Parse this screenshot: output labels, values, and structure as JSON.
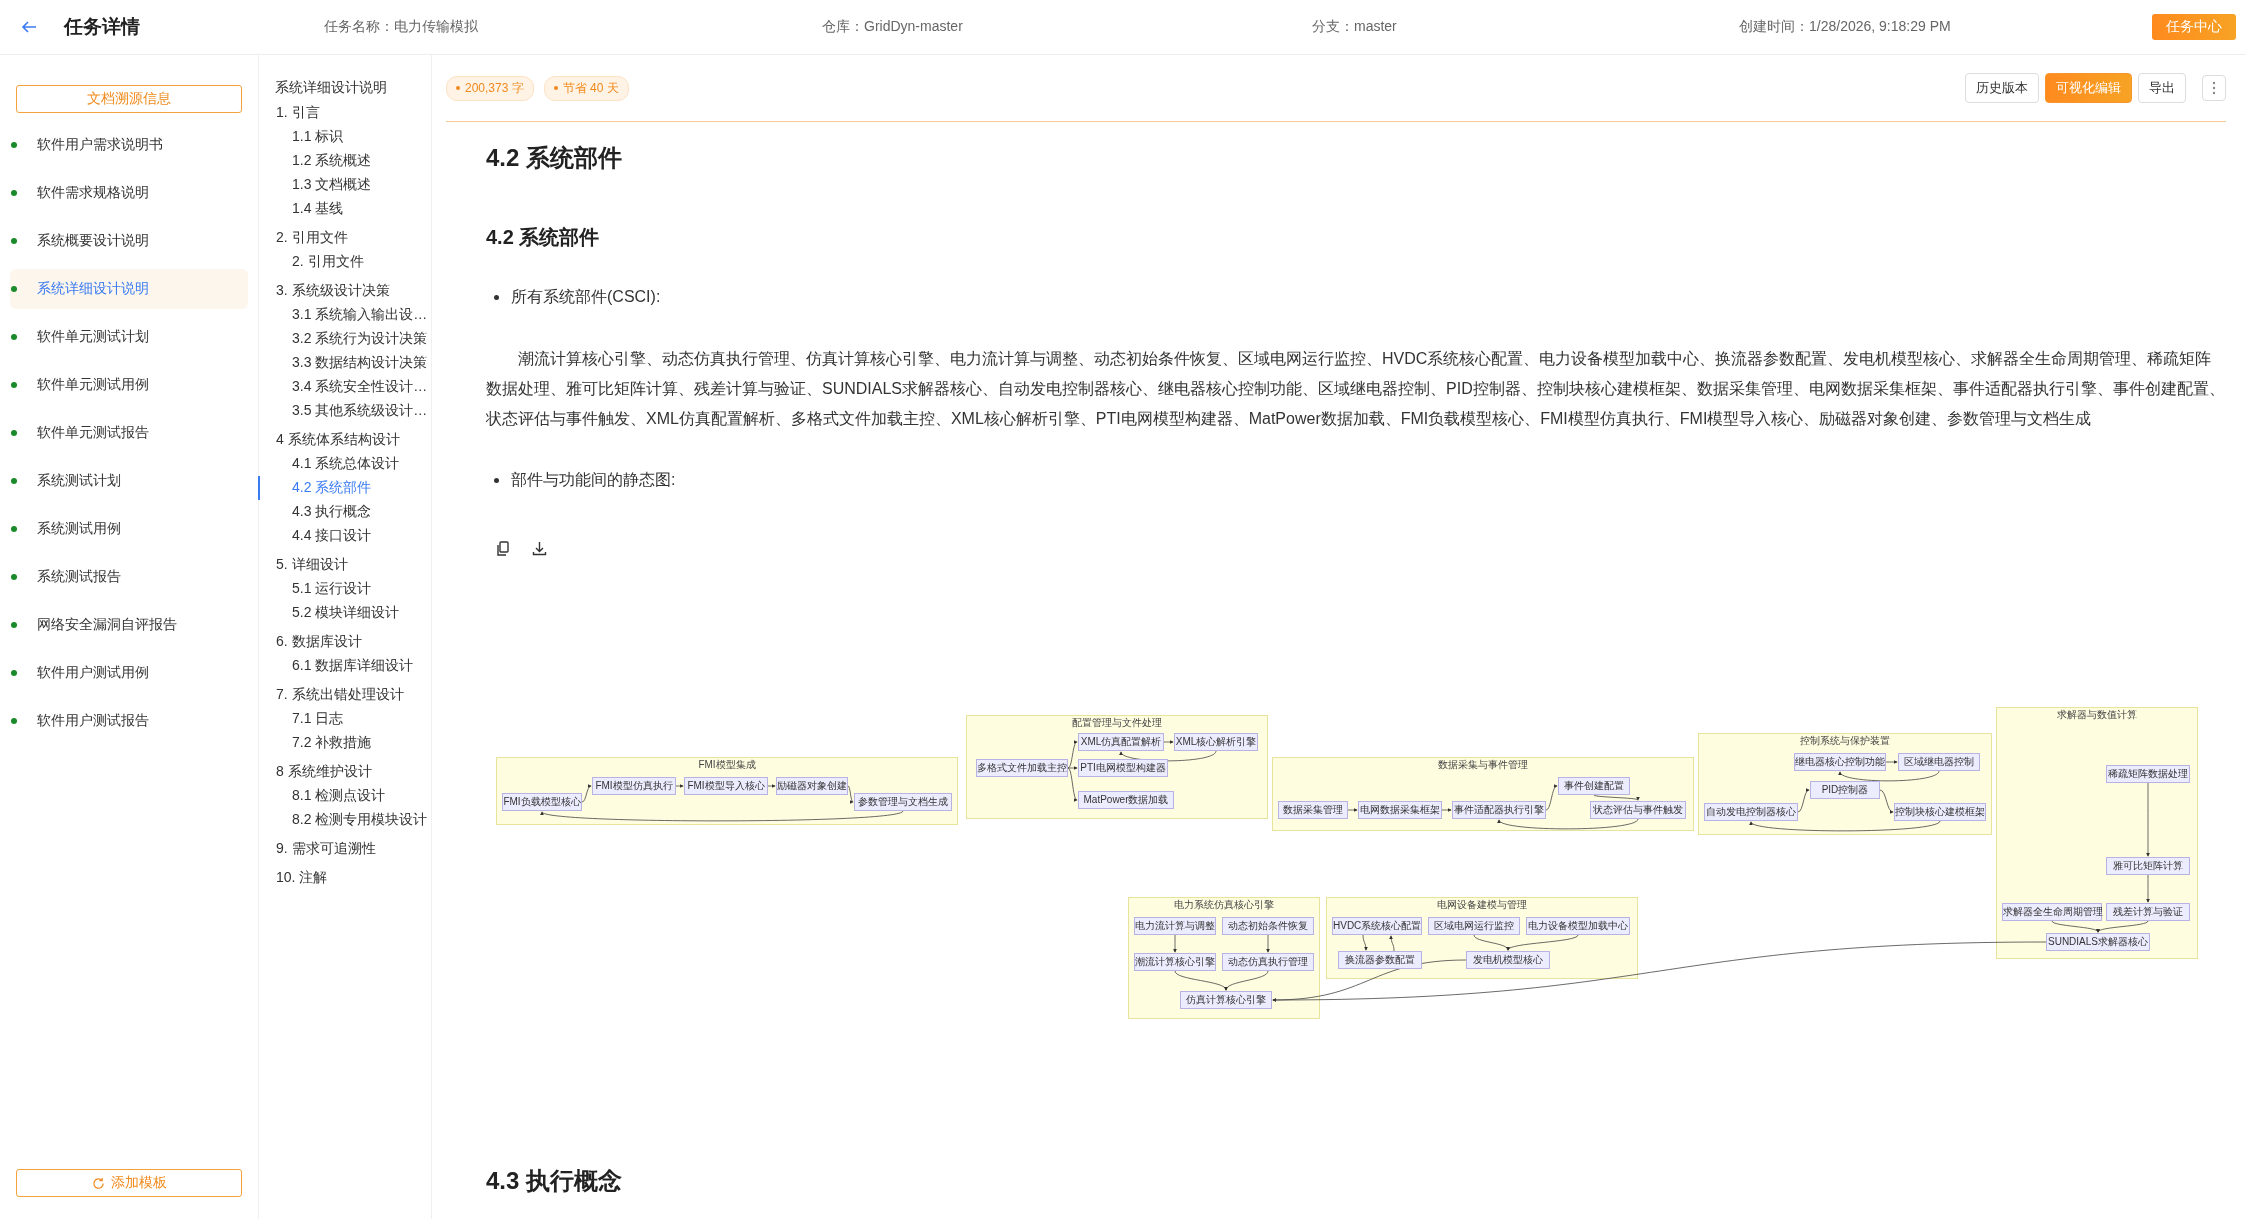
{
  "header": {
    "title": "任务详情",
    "meta": [
      "任务名称：电力传输模拟",
      "仓库：GridDyn-master",
      "分支：master",
      "创建时间：1/28/2026, 9:18:29 PM"
    ],
    "button": "任务中心"
  },
  "doc_list": {
    "button": "文档溯源信息",
    "items": [
      {
        "label": "软件用户需求说明书",
        "selected": false
      },
      {
        "label": "软件需求规格说明",
        "selected": false
      },
      {
        "label": "系统概要设计说明",
        "selected": false
      },
      {
        "label": "系统详细设计说明",
        "selected": true
      },
      {
        "label": "软件单元测试计划",
        "selected": false
      },
      {
        "label": "软件单元测试用例",
        "selected": false
      },
      {
        "label": "软件单元测试报告",
        "selected": false
      },
      {
        "label": "系统测试计划",
        "selected": false
      },
      {
        "label": "系统测试用例",
        "selected": false
      },
      {
        "label": "系统测试报告",
        "selected": false
      },
      {
        "label": "网络安全漏洞自评报告",
        "selected": false
      },
      {
        "label": "软件用户测试用例",
        "selected": false
      },
      {
        "label": "软件用户测试报告",
        "selected": false
      }
    ],
    "add_button": "添加模板"
  },
  "toc": {
    "title": "系统详细设计说明",
    "sections": [
      {
        "label": "1. 引言",
        "selected": false,
        "children": [
          {
            "label": "1.1 标识",
            "selected": false
          },
          {
            "label": "1.2 系统概述",
            "selected": false
          },
          {
            "label": "1.3 文档概述",
            "selected": false
          },
          {
            "label": "1.4 基线",
            "selected": false
          }
        ]
      },
      {
        "label": "2. 引用文件",
        "selected": false,
        "children": [
          {
            "label": "2. 引用文件",
            "selected": false
          }
        ]
      },
      {
        "label": "3. 系统级设计决策",
        "selected": false,
        "children": [
          {
            "label": "3.1 系统输入输出设…",
            "selected": false
          },
          {
            "label": "3.2 系统行为设计决策",
            "selected": false
          },
          {
            "label": "3.3 数据结构设计决策",
            "selected": false
          },
          {
            "label": "3.4 系统安全性设计…",
            "selected": false
          },
          {
            "label": "3.5 其他系统级设计…",
            "selected": false
          }
        ]
      },
      {
        "label": "4 系统体系结构设计",
        "selected": false,
        "children": [
          {
            "label": "4.1 系统总体设计",
            "selected": false
          },
          {
            "label": "4.2 系统部件",
            "selected": true
          },
          {
            "label": "4.3 执行概念",
            "selected": false
          },
          {
            "label": "4.4 接口设计",
            "selected": false
          }
        ]
      },
      {
        "label": "5. 详细设计",
        "selected": false,
        "children": [
          {
            "label": "5.1 运行设计",
            "selected": false
          },
          {
            "label": "5.2 模块详细设计",
            "selected": false
          }
        ]
      },
      {
        "label": "6. 数据库设计",
        "selected": false,
        "children": [
          {
            "label": "6.1 数据库详细设计",
            "selected": false
          }
        ]
      },
      {
        "label": "7. 系统出错处理设计",
        "selected": false,
        "children": [
          {
            "label": "7.1 日志",
            "selected": false
          },
          {
            "label": "7.2 补救措施",
            "selected": false
          }
        ]
      },
      {
        "label": "8 系统维护设计",
        "selected": false,
        "children": [
          {
            "label": "8.1 检测点设计",
            "selected": false
          },
          {
            "label": "8.2 检测专用模块设计",
            "selected": false
          }
        ]
      },
      {
        "label": "9. 需求可追溯性",
        "selected": false
      },
      {
        "label": "10. 注解",
        "selected": false
      }
    ]
  },
  "toolbar": {
    "tags": [
      "200,373 字",
      "节省 40 天"
    ],
    "buttons": [
      {
        "label": "历史版本",
        "kind": "plain"
      },
      {
        "label": "可视化编辑",
        "kind": "primary"
      },
      {
        "label": "导出",
        "kind": "plain"
      }
    ]
  },
  "document": {
    "heading": "4.2 系统部件",
    "subheading": "4.2 系统部件",
    "bullet_1": "所有系统部件(CSCI):",
    "paragraph": "潮流计算核心引擎、动态仿真执行管理、仿真计算核心引擎、电力流计算与调整、动态初始条件恢复、区域电网运行监控、HVDC系统核心配置、电力设备模型加载中心、换流器参数配置、发电机模型核心、求解器全生命周期管理、稀疏矩阵数据处理、雅可比矩阵计算、残差计算与验证、SUNDIALS求解器核心、自动发电控制器核心、继电器核心控制功能、区域继电器控制、PID控制器、控制块核心建模框架、数据采集管理、电网数据采集框架、事件适配器执行引擎、事件创建配置、状态评估与事件触发、XML仿真配置解析、多格式文件加载主控、XML核心解析引擎、PTI电网模型构建器、MatPower数据加载、FMI负载模型核心、FMI模型仿真执行、FMI模型导入核心、励磁器对象创建、参数管理与文档生成",
    "bullet_2": "部件与功能间的静态图:",
    "next_heading": "4.3 执行概念"
  },
  "diagram": {
    "clusters": [
      {
        "title": "FMI模型集成",
        "nodes": [
          "FMI负载模型核心",
          "FMI模型仿真执行",
          "FMI模型导入核心",
          "励磁器对象创建",
          "参数管理与文档生成"
        ]
      },
      {
        "title": "配置管理与文件处理",
        "nodes": [
          "多格式文件加载主控",
          "XML仿真配置解析",
          "XML核心解析引擎",
          "PTI电网模型构建器",
          "MatPower数据加载"
        ]
      },
      {
        "title": "数据采集与事件管理",
        "nodes": [
          "数据采集管理",
          "电网数据采集框架",
          "事件适配器执行引擎",
          "事件创建配置",
          "状态评估与事件触发"
        ]
      },
      {
        "title": "控制系统与保护装置",
        "nodes": [
          "继电器核心控制功能",
          "区域继电器控制",
          "自动发电控制器核心",
          "PID控制器",
          "控制块核心建模框架"
        ]
      },
      {
        "title": "求解器与数值计算",
        "nodes": [
          "稀疏矩阵数据处理",
          "雅可比矩阵计算",
          "求解器全生命周期管理",
          "残差计算与验证",
          "SUNDIALS求解器核心"
        ]
      },
      {
        "title": "电力系统仿真核心引擎",
        "nodes": [
          "电力流计算与调整",
          "动态初始条件恢复",
          "潮流计算核心引擎",
          "动态仿真执行管理",
          "仿真计算核心引擎"
        ]
      },
      {
        "title": "电网设备建模与管理",
        "nodes": [
          "HVDC系统核心配置",
          "区域电网运行监控",
          "电力设备模型加载中心",
          "换流器参数配置",
          "发电机模型核心"
        ]
      }
    ]
  }
}
